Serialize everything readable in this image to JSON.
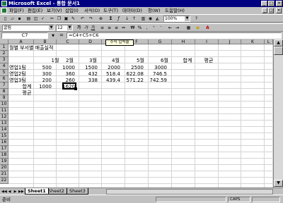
{
  "window": {
    "title": "Microsoft Excel - 통합 문서1",
    "buttons": [
      "_",
      "□",
      "×"
    ]
  },
  "menubar": {
    "items": [
      "파일(F)",
      "편집(E)",
      "보기(V)",
      "삽입(I)",
      "서식(O)",
      "도구(T)",
      "데이터(D)",
      "창(W)",
      "도움말(H)"
    ],
    "doc_buttons": [
      "_",
      "□",
      "×"
    ]
  },
  "toolbar": {
    "zoom": "100%",
    "font_name": "굴림",
    "font_size": "12"
  },
  "formula_bar": {
    "name_box": "C7",
    "equals": "=",
    "formula": "=C4+C5+C6"
  },
  "tooltip": "수식 입력줄",
  "sheet": {
    "columns": [
      "A",
      "B",
      "C",
      "D",
      "E",
      "F",
      "G",
      "H",
      "I",
      "J",
      "K",
      "L"
    ],
    "rows": [
      "1",
      "2",
      "3",
      "4",
      "5",
      "6",
      "7",
      "8",
      "9",
      "10",
      "11",
      "12",
      "13",
      "14",
      "15",
      "16",
      "17",
      "18",
      "19",
      "20",
      "21",
      "22"
    ],
    "title": "월별 부서별 매출실적",
    "month_headers": [
      "1월",
      "2월",
      "3월",
      "4월",
      "5월",
      "6월",
      "합계",
      "평균"
    ],
    "data_rows": [
      {
        "label": "영업1팀",
        "values": [
          "500",
          "1000",
          "1500",
          "2000",
          "2500",
          "3000"
        ]
      },
      {
        "label": "영업2팀",
        "values": [
          "300",
          "360",
          "432",
          "518.4",
          "622.08",
          "746.5"
        ]
      },
      {
        "label": "영업3팀",
        "values": [
          "200",
          "260",
          "338",
          "439.4",
          "571.22",
          "742.59"
        ]
      }
    ],
    "total_label": "합계",
    "total_values": [
      "1000",
      "1620"
    ],
    "avg_label": "평균"
  },
  "sheet_tabs": [
    "Sheet1",
    "Sheet2",
    "Sheet3"
  ],
  "status": {
    "text": "준비",
    "caps": "CAPS"
  }
}
